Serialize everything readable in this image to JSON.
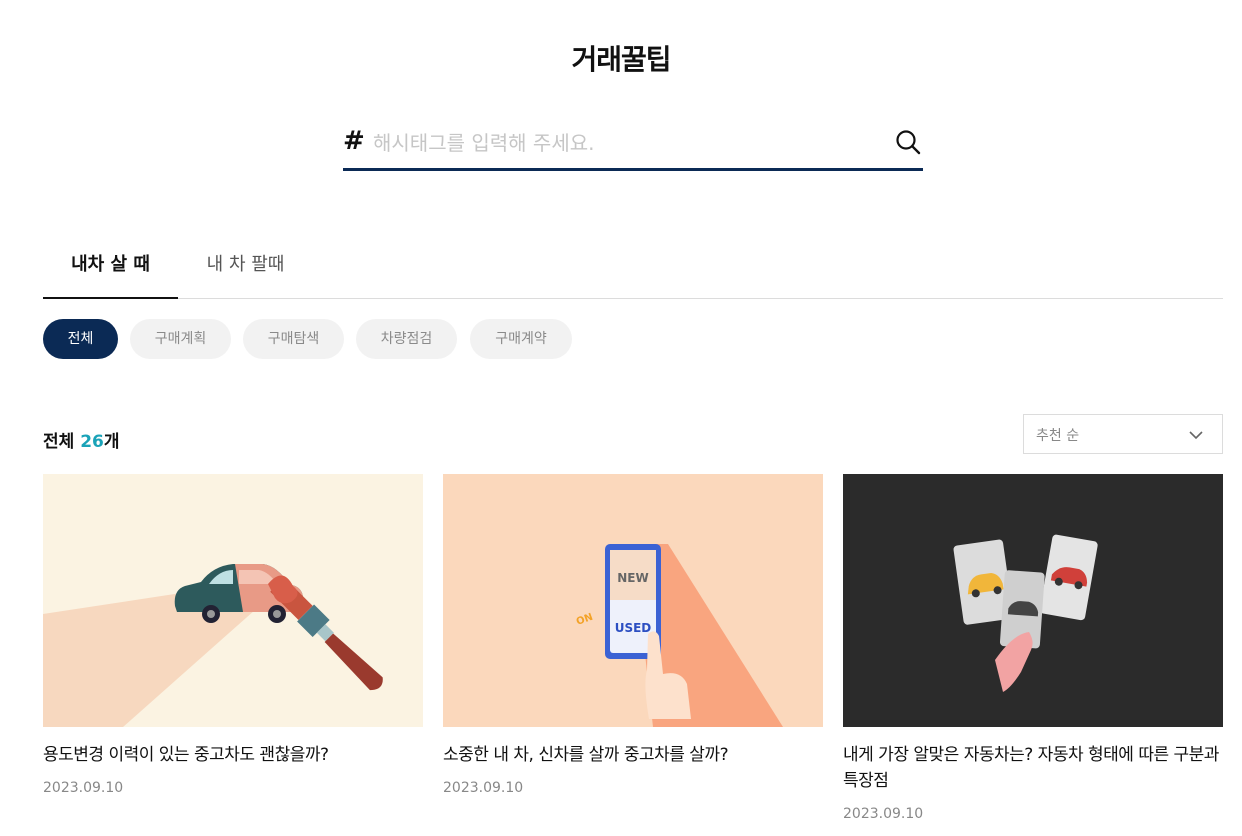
{
  "header": {
    "title": "거래꿀팁"
  },
  "search": {
    "hash": "#",
    "placeholder": "해시태그를 입력해 주세요.",
    "value": ""
  },
  "tabs": [
    {
      "label": "내차 살 때",
      "active": true
    },
    {
      "label": "내 차 팔때",
      "active": false
    }
  ],
  "chips": [
    {
      "label": "전체",
      "active": true
    },
    {
      "label": "구매계획",
      "active": false
    },
    {
      "label": "구매탐색",
      "active": false
    },
    {
      "label": "차량점검",
      "active": false
    },
    {
      "label": "구매계약",
      "active": false
    }
  ],
  "summary": {
    "label": "전체",
    "count": "26",
    "unit": "개"
  },
  "sort": {
    "selected": "추천 순"
  },
  "cards": [
    {
      "title": "용도변경 이력이 있는 중고차도 괜찮을까?",
      "date": "2023.09.10",
      "image": "car-paint-brush-illustration"
    },
    {
      "title": "소중한 내 차, 신차를 살까 중고차를 살까?",
      "date": "2023.09.10",
      "image": "new-used-switch-illustration",
      "image_text": {
        "top": "NEW",
        "bottom": "USED",
        "tag": "ON"
      }
    },
    {
      "title": "내게 가장 알맞은 자동차는? 자동차 형태에 따른 구분과 특장점",
      "date": "2023.09.10",
      "image": "car-cards-illustration"
    }
  ],
  "colors": {
    "accent": "#0b2a55",
    "count": "#1aa3b8"
  }
}
